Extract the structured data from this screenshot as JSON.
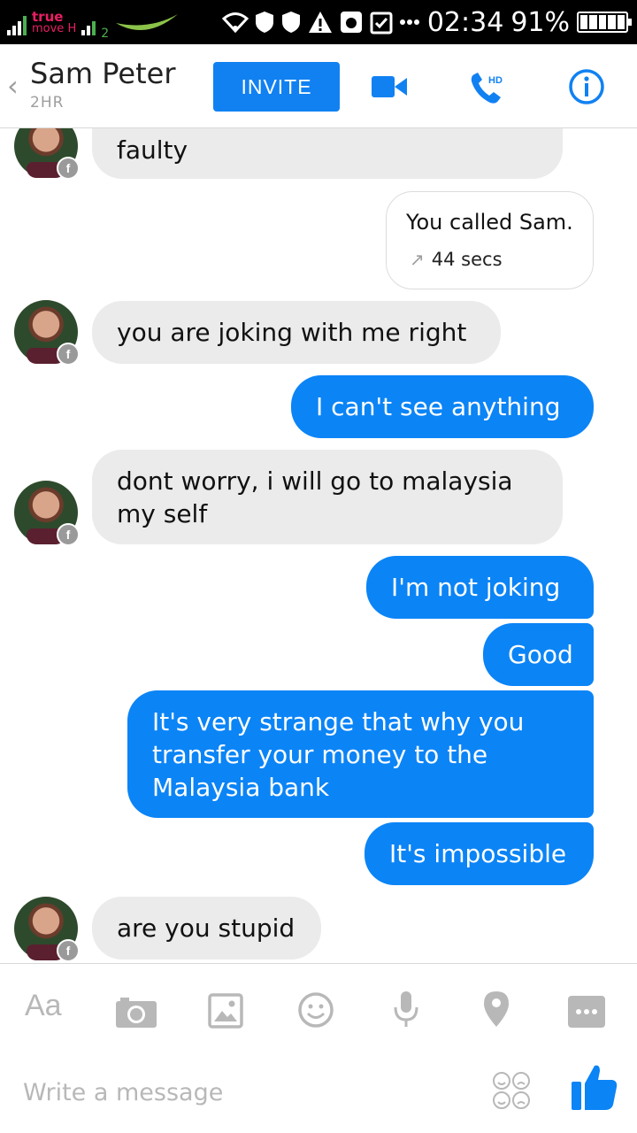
{
  "status_bar": {
    "carrier_line1": "true",
    "carrier_line2": "move H",
    "sim2_label": "2",
    "time": "02:34",
    "battery": "91%"
  },
  "header": {
    "back_glyph": "‹",
    "contact_name": "Sam Peter",
    "contact_status": "2HR",
    "invite_label": "INVITE",
    "hd_label": "HD",
    "icons": [
      "video-icon",
      "phone-hd-icon",
      "info-icon"
    ],
    "accent_color": "#1181f2"
  },
  "messages": [
    {
      "side": "in",
      "text": "faulty"
    },
    {
      "side": "call",
      "title": "You called Sam.",
      "duration": "44 secs"
    },
    {
      "side": "in",
      "text": "you are joking with me right"
    },
    {
      "side": "out",
      "text": "I can't see anything"
    },
    {
      "side": "in",
      "text": "dont worry, i will go to malaysia my self"
    },
    {
      "side": "out",
      "text": "I'm not joking"
    },
    {
      "side": "out",
      "text": "Good"
    },
    {
      "side": "out",
      "text": "It's very strange that why you transfer your money to the Malaysia bank"
    },
    {
      "side": "out",
      "text": "It's impossible"
    },
    {
      "side": "in",
      "text": "are you stupid"
    }
  ],
  "avatar_badge": "f",
  "composer": {
    "aa_label": "Aa",
    "placeholder": "Write a message",
    "toolbar_icons": [
      "text-format-icon",
      "camera-icon",
      "gallery-icon",
      "emoji-icon",
      "microphone-icon",
      "location-icon",
      "more-icon"
    ]
  },
  "colors": {
    "outgoing_bubble": "#0b84f6",
    "incoming_bubble": "#ebebeb",
    "icon_gray": "#b8b8b8"
  }
}
